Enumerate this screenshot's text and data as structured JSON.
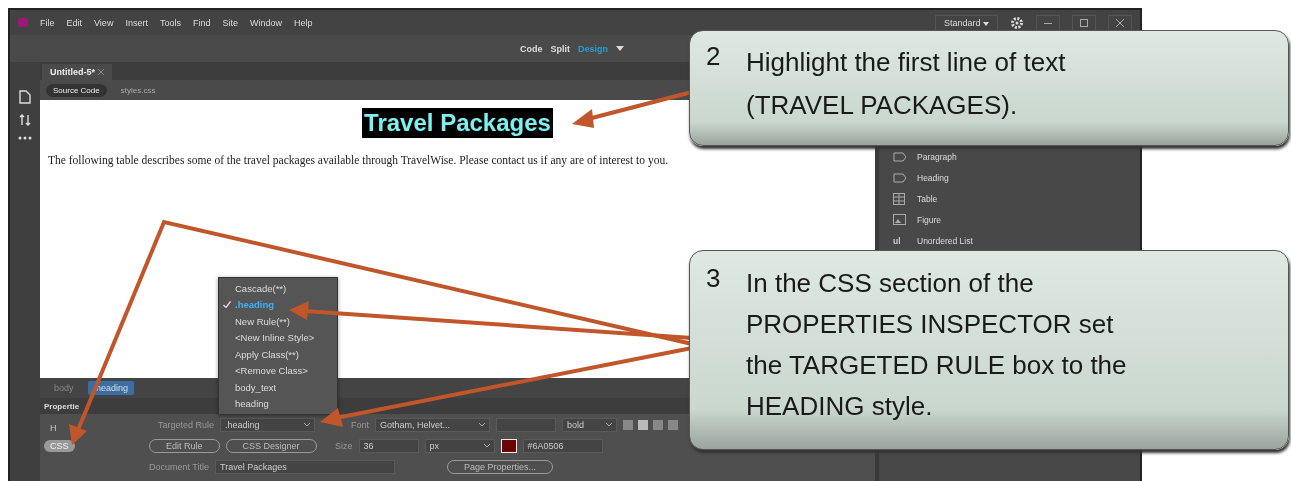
{
  "menu_bar": {
    "items": [
      "File",
      "Edit",
      "View",
      "Insert",
      "Tools",
      "Find",
      "Site",
      "Window",
      "Help"
    ],
    "workspace": "Standard"
  },
  "view_switcher": [
    {
      "label": "Code",
      "selected": false
    },
    {
      "label": "Split",
      "selected": false
    },
    {
      "label": "Design",
      "selected": true
    }
  ],
  "document_tabs": [
    {
      "label": "Untitled-5*",
      "selected": true
    }
  ],
  "related_files": [
    {
      "label": "Source Code",
      "selected": true
    },
    {
      "label": "styles.css",
      "selected": false
    }
  ],
  "design_view": {
    "heading": "Travel Packages",
    "heading_selected": true,
    "paragraph": "The following table describes some of the travel packages available through TravelWise. Please contact us if any are of interest to you."
  },
  "insert_panel": [
    {
      "kind": "paragraph",
      "label": "Paragraph"
    },
    {
      "kind": "heading",
      "label": "Heading"
    },
    {
      "kind": "table",
      "label": "Table"
    },
    {
      "kind": "figure",
      "label": "Figure"
    },
    {
      "kind": "text",
      "glyph": "ul",
      "label": "Unordered List"
    }
  ],
  "tag_selector": [
    {
      "label": "body",
      "selected": false
    },
    {
      "label": ".heading",
      "selected": true
    }
  ],
  "properties": {
    "title": "Propertie",
    "mode_buttons": [
      {
        "label": "H",
        "selected": false
      },
      {
        "label": "CSS",
        "selected": true
      }
    ],
    "targeted_rule_label": "Targeted Rule",
    "targeted_rule": ".heading",
    "edit_rule": "Edit Rule",
    "css_designer": "CSS Designer",
    "font_label": "Font",
    "font": "Gotham, Helvet...",
    "weight": "bold",
    "size_label": "Size",
    "size": "36",
    "unit": "px",
    "color_text": "#6A0506",
    "document_title_label": "Document Title",
    "document_title": "Travel Packages",
    "page_properties": "Page Properties..."
  },
  "rule_menu": [
    {
      "label": "Cascade(**)",
      "selected": false
    },
    {
      "label": ".heading",
      "selected": true
    },
    {
      "label": "New Rule(**)",
      "selected": false
    },
    {
      "label": "<New Inline Style>",
      "selected": false
    },
    {
      "label": "Apply Class(**)",
      "selected": false
    },
    {
      "label": "<Remove Class>",
      "selected": false
    },
    {
      "label": "body_text",
      "selected": false
    },
    {
      "label": "heading",
      "selected": false
    }
  ],
  "callouts": [
    {
      "number": "2",
      "lines": [
        "Highlight the first line of text",
        "(TRAVEL PACKAGES)."
      ]
    },
    {
      "number": "3",
      "lines": [
        "In the CSS section of the",
        "PROPERTIES INSPECTOR set",
        "the TARGETED RULE box to the",
        "HEADING style."
      ]
    }
  ]
}
